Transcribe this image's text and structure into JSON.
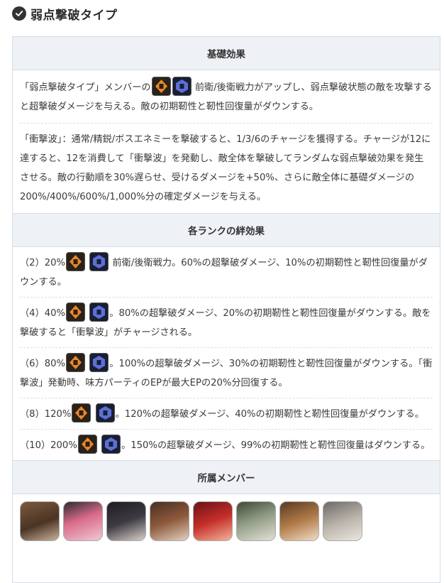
{
  "section": {
    "title": "弱点撃破タイプ"
  },
  "table": {
    "header_basic": "基礎効果",
    "basic_p1_a": "「弱点撃破タイプ」メンバーの",
    "basic_p1_b": " 前衛/後衛戦力がアップし、弱点撃破状態の敵を攻撃すると超撃破ダメージを与える。敵の初期靭性と靭性回復量がダウンする。",
    "basic_p2": "「衝撃波」：通常/精鋭/ボスエネミーを撃破すると、1/3/6のチャージを獲得する。チャージが12に達すると、12を消費して「衝撃波」を発動し、敵全体を撃破してランダムな弱点撃破効果を発生させる。敵の行動順を30%遅らせ、受けるダメージを+50%、さらに敵全体に基礎ダメージの200%/400%/600%/1,000%分の確定ダメージを与える。",
    "header_rank": "各ランクの絆効果",
    "ranks": [
      {
        "prefix": "（2）20%",
        "text": " 前衛/後衛戦力。60%の超撃破ダメージ、10%の初期靭性と靭性回復量がダウンする。"
      },
      {
        "prefix": "（4）40%",
        "text": "。80%の超撃破ダメージ、20%の初期靭性と靭性回復量がダウンする。敵を撃破すると「衝撃波」がチャージされる。"
      },
      {
        "prefix": "（6）80%",
        "text": "。100%の超撃破ダメージ、30%の初期靭性と靭性回復量がダウンする。「衝撃波」発動時、味方パーティのEPが最大EPの20%分回復する。"
      },
      {
        "prefix": "（8）120%",
        "text": "。120%の超撃破ダメージ、40%の初期靭性と靭性回復量がダウンする。"
      },
      {
        "prefix": "（10）200%",
        "text": "。150%の超撃破ダメージ、99%の初期靭性と靭性回復量はダウンする。"
      }
    ],
    "header_members": "所属メンバー"
  },
  "colors": {
    "header_bg": "#eef1f5",
    "border": "#d7dde3",
    "icon_orange": "#e8872a",
    "icon_blue": "#5b6fd6"
  },
  "icons": {
    "check": "check-circle-icon",
    "front": "front-position-icon",
    "back": "back-position-icon"
  },
  "members": [
    {
      "portrait": "member-portrait-1"
    },
    {
      "portrait": "member-portrait-2"
    },
    {
      "portrait": "member-portrait-3"
    },
    {
      "portrait": "member-portrait-4"
    },
    {
      "portrait": "member-portrait-5"
    },
    {
      "portrait": "member-portrait-6"
    },
    {
      "portrait": "member-portrait-7"
    },
    {
      "portrait": "member-portrait-8"
    }
  ]
}
